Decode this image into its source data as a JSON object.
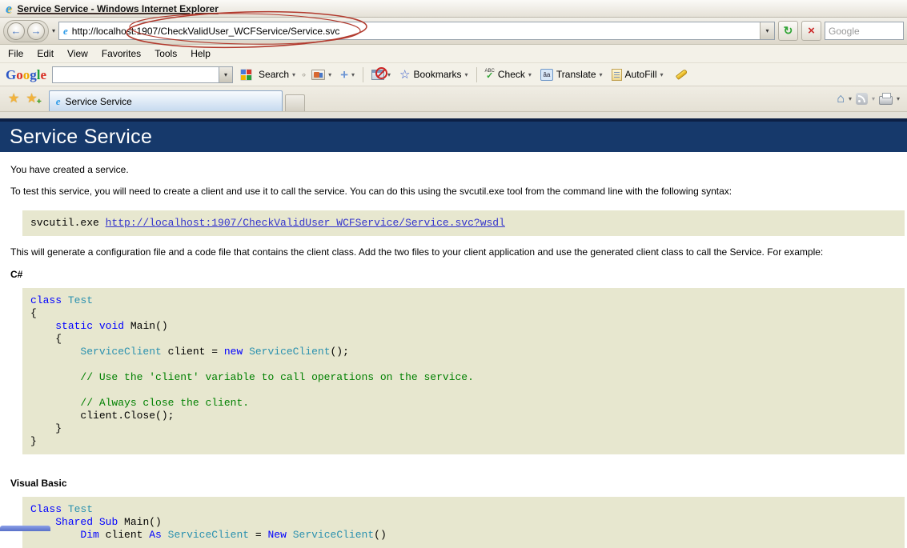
{
  "window": {
    "title": "Service Service - Windows Internet Explorer"
  },
  "navigation": {
    "address_url": "http://localhost:1907/CheckValidUser_WCFService/Service.svc",
    "search_placeholder": "Google"
  },
  "menu_bar": {
    "items": [
      "File",
      "Edit",
      "View",
      "Favorites",
      "Tools",
      "Help"
    ]
  },
  "google_toolbar": {
    "logo_letters": [
      {
        "ch": "G",
        "color": "#2A56C6"
      },
      {
        "ch": "o",
        "color": "#D93025"
      },
      {
        "ch": "o",
        "color": "#F0A800"
      },
      {
        "ch": "g",
        "color": "#2A56C6"
      },
      {
        "ch": "l",
        "color": "#1E9E3E"
      },
      {
        "ch": "e",
        "color": "#D93025"
      }
    ],
    "search_label": "Search",
    "bookmarks_label": "Bookmarks",
    "check_abc": "ABC",
    "check_label": "Check",
    "translate_icon_text": "âa",
    "translate_label": "Translate",
    "autofill_label": "AutoFill"
  },
  "tab_bar": {
    "active_tab": "Service Service"
  },
  "content": {
    "banner_title": "Service Service",
    "created_text": "You have created a service.",
    "test_text": "To test this service, you will need to create a client and use it to call the service. You can do this using the svcutil.exe tool from the command line with the following syntax:",
    "svcutil_prefix": "svcutil.exe ",
    "svcutil_link": "http://localhost:1907/CheckValidUser_WCFService/Service.svc?wsdl",
    "generate_text": "This will generate a configuration file and a code file that contains the client class. Add the two files to your client application and use the generated client class to call the Service. For example:",
    "csharp_heading": "C#",
    "vb_heading": "Visual Basic"
  },
  "code": {
    "csharp_lines": [
      [
        [
          "kw",
          "class"
        ],
        [
          "pl",
          " "
        ],
        [
          "ty",
          "Test"
        ]
      ],
      [
        [
          "pl",
          "{"
        ]
      ],
      [
        [
          "pl",
          "    "
        ],
        [
          "kw",
          "static"
        ],
        [
          "pl",
          " "
        ],
        [
          "kw",
          "void"
        ],
        [
          "pl",
          " Main()"
        ]
      ],
      [
        [
          "pl",
          "    {"
        ]
      ],
      [
        [
          "pl",
          "        "
        ],
        [
          "ty",
          "ServiceClient"
        ],
        [
          "pl",
          " client = "
        ],
        [
          "kw",
          "new"
        ],
        [
          "pl",
          " "
        ],
        [
          "ty",
          "ServiceClient"
        ],
        [
          "pl",
          "();"
        ]
      ],
      [
        [
          "pl",
          ""
        ]
      ],
      [
        [
          "pl",
          "        "
        ],
        [
          "cm",
          "// Use the 'client' variable to call operations on the service."
        ]
      ],
      [
        [
          "pl",
          ""
        ]
      ],
      [
        [
          "pl",
          "        "
        ],
        [
          "cm",
          "// Always close the client."
        ]
      ],
      [
        [
          "pl",
          "        client.Close();"
        ]
      ],
      [
        [
          "pl",
          "    }"
        ]
      ],
      [
        [
          "pl",
          "}"
        ]
      ]
    ],
    "vb_lines": [
      [
        [
          "kw",
          "Class"
        ],
        [
          "pl",
          " "
        ],
        [
          "ty",
          "Test"
        ]
      ],
      [
        [
          "pl",
          "    "
        ],
        [
          "kw",
          "Shared"
        ],
        [
          "pl",
          " "
        ],
        [
          "kw",
          "Sub"
        ],
        [
          "pl",
          " Main()"
        ]
      ],
      [
        [
          "pl",
          "        "
        ],
        [
          "kw",
          "Dim"
        ],
        [
          "pl",
          " client "
        ],
        [
          "kw",
          "As"
        ],
        [
          "pl",
          " "
        ],
        [
          "ty",
          "ServiceClient"
        ],
        [
          "pl",
          " = "
        ],
        [
          "kw",
          "New"
        ],
        [
          "pl",
          " "
        ],
        [
          "ty",
          "ServiceClient"
        ],
        [
          "pl",
          "()"
        ]
      ]
    ]
  },
  "glyphs": {
    "ie": "e",
    "back_arrow": "←",
    "forward_arrow": "→",
    "dropdown": "▾",
    "refresh": "↻",
    "stop": "×",
    "star": "★",
    "star_outline": "☆",
    "plus": "+",
    "home": "⌂",
    "check": "✓",
    "handle": "‹›"
  },
  "colors": {
    "banner_bg": "#16396B",
    "banner_top_edge": "#0C2045",
    "code_bg": "#E7E7CF",
    "keyword": "#0000FF",
    "type": "#2B91AF",
    "comment": "#008000",
    "link": "#3333CC",
    "annotation_red": "#B23A2E"
  }
}
